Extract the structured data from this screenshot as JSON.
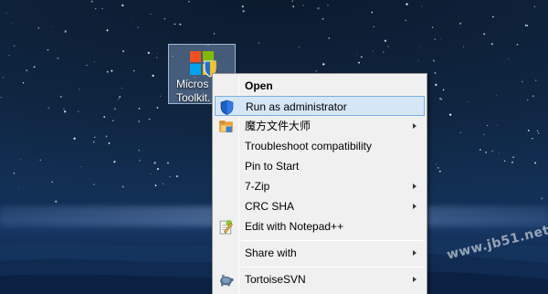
{
  "desktop": {
    "icon": {
      "name": "microsoft-toolkit",
      "caption_line1": "Micros",
      "caption_line2": "Toolkit."
    },
    "watermark": "www.jb51.net"
  },
  "context_menu": {
    "items": [
      {
        "label": "Open",
        "bold": true,
        "icon": "",
        "submenu": false
      },
      {
        "label": "Run as administrator",
        "bold": false,
        "icon": "shield-icon",
        "submenu": false,
        "highlighted": true
      },
      {
        "label": "魔方文件大师",
        "bold": false,
        "icon": "folder-icon",
        "submenu": true
      },
      {
        "label": "Troubleshoot compatibility",
        "bold": false,
        "icon": "",
        "submenu": false
      },
      {
        "label": "Pin to Start",
        "bold": false,
        "icon": "",
        "submenu": false
      },
      {
        "label": "7-Zip",
        "bold": false,
        "icon": "",
        "submenu": true
      },
      {
        "label": "CRC SHA",
        "bold": false,
        "icon": "",
        "submenu": true
      },
      {
        "label": "Edit with Notepad++",
        "bold": false,
        "icon": "notepad-icon",
        "submenu": false
      },
      {
        "label": "Share with",
        "bold": false,
        "icon": "",
        "submenu": true
      },
      {
        "label": "TortoiseSVN",
        "bold": false,
        "icon": "tortoise-icon",
        "submenu": true
      }
    ]
  },
  "colors": {
    "highlight_bg": "#d5e6f7",
    "highlight_border": "#7aaede",
    "menu_bg": "#f0f0f0"
  }
}
